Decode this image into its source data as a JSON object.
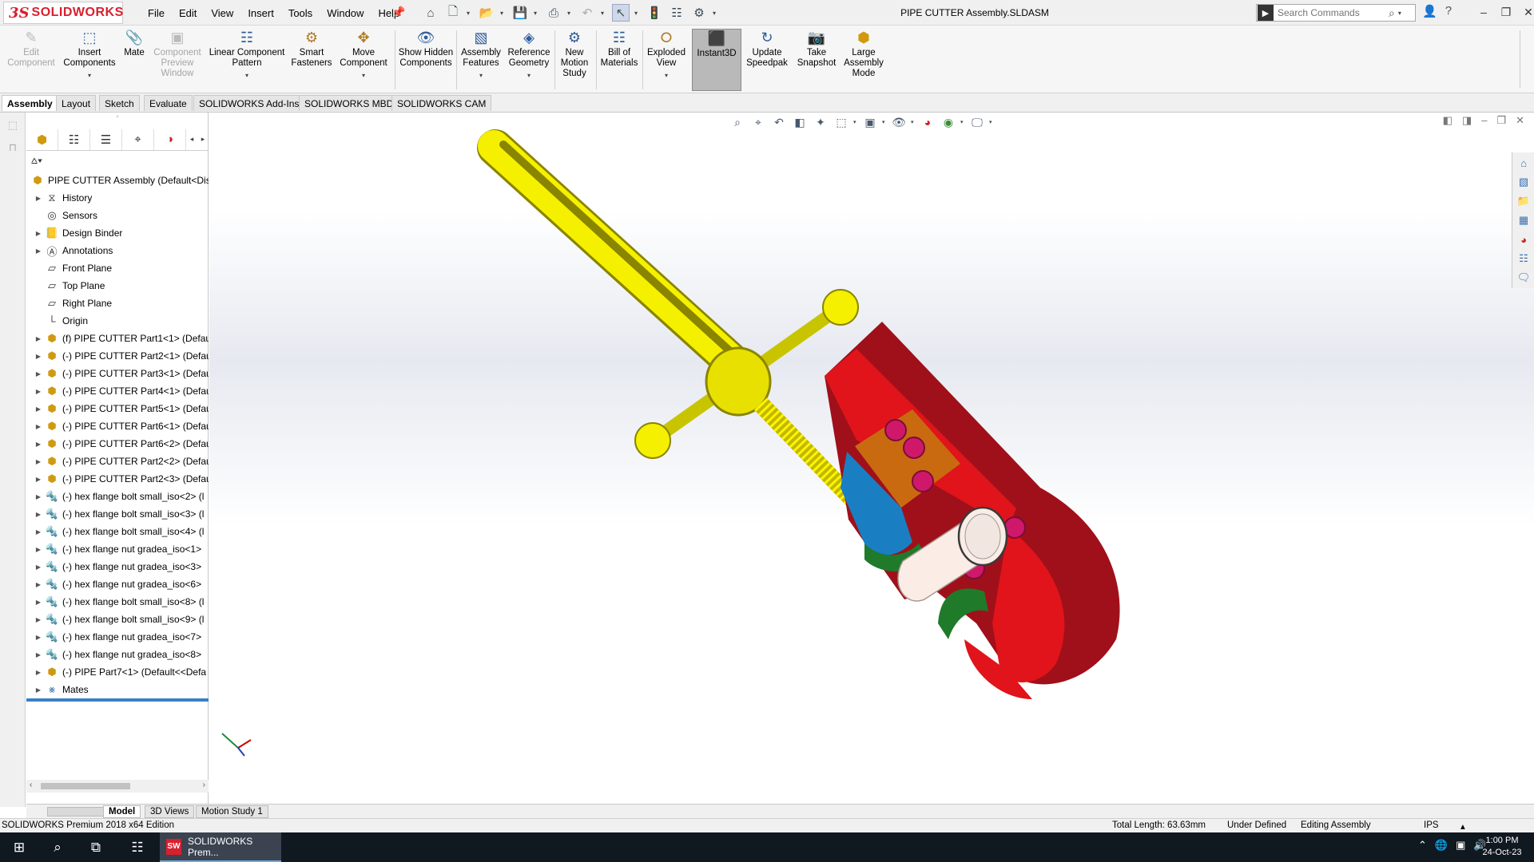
{
  "app": {
    "logo_ds": "3S",
    "logo_name": "SOLIDWORKS",
    "title": "PIPE CUTTER Assembly.SLDASM",
    "menus": [
      "File",
      "Edit",
      "View",
      "Insert",
      "Tools",
      "Window",
      "Help"
    ],
    "search_placeholder": "Search Commands"
  },
  "ribbon": [
    {
      "label": "Edit Component",
      "icon": "edit-component-icon",
      "disabled": true
    },
    {
      "label": "Insert Components",
      "icon": "insert-components-icon",
      "disabled": false,
      "dropdown": true
    },
    {
      "label": "Mate",
      "icon": "mate-icon",
      "disabled": false
    },
    {
      "label": "Component Preview Window",
      "icon": "component-preview-icon",
      "disabled": true
    },
    {
      "label": "Linear Component Pattern",
      "icon": "linear-pattern-icon",
      "disabled": false,
      "dropdown": true
    },
    {
      "label": "Smart Fasteners",
      "icon": "smart-fasteners-icon",
      "disabled": false
    },
    {
      "label": "Move Component",
      "icon": "move-component-icon",
      "disabled": false,
      "dropdown": true
    },
    {
      "label": "Show Hidden Components",
      "icon": "show-hidden-icon",
      "disabled": false
    },
    {
      "label": "Assembly Features",
      "icon": "assembly-features-icon",
      "disabled": false,
      "dropdown": true
    },
    {
      "label": "Reference Geometry",
      "icon": "reference-geometry-icon",
      "disabled": false,
      "dropdown": true
    },
    {
      "label": "New Motion Study",
      "icon": "motion-study-icon",
      "disabled": false
    },
    {
      "label": "Bill of Materials",
      "icon": "bom-icon",
      "disabled": false
    },
    {
      "label": "Exploded View",
      "icon": "exploded-view-icon",
      "disabled": false,
      "dropdown": true
    },
    {
      "label": "Instant3D",
      "icon": "instant3d-icon",
      "disabled": false,
      "active": true
    },
    {
      "label": "Update Speedpak",
      "icon": "speedpak-icon",
      "disabled": false
    },
    {
      "label": "Take Snapshot",
      "icon": "camera-icon",
      "disabled": false
    },
    {
      "label": "Large Assembly Mode",
      "icon": "large-assembly-icon",
      "disabled": false
    }
  ],
  "tabs": [
    "Assembly",
    "Layout",
    "Sketch",
    "Evaluate",
    "SOLIDWORKS Add-Ins",
    "SOLIDWORKS MBD",
    "SOLIDWORKS CAM"
  ],
  "tree": {
    "root": "PIPE CUTTER Assembly  (Default<Disp",
    "items": [
      {
        "label": "History",
        "icon": "history-icon",
        "expand": true
      },
      {
        "label": "Sensors",
        "icon": "sensors-icon",
        "expand": false
      },
      {
        "label": "Design Binder",
        "icon": "design-binder-icon",
        "expand": true
      },
      {
        "label": "Annotations",
        "icon": "annotations-icon",
        "expand": true
      },
      {
        "label": "Front Plane",
        "icon": "plane-icon",
        "expand": false
      },
      {
        "label": "Top Plane",
        "icon": "plane-icon",
        "expand": false
      },
      {
        "label": "Right Plane",
        "icon": "plane-icon",
        "expand": false
      },
      {
        "label": "Origin",
        "icon": "origin-icon",
        "expand": false
      },
      {
        "label": "(f) PIPE CUTTER Part1<1> (Default",
        "icon": "part-icon",
        "expand": true
      },
      {
        "label": "(-) PIPE CUTTER Part2<1> (Defaul",
        "icon": "part-icon",
        "expand": true
      },
      {
        "label": "(-) PIPE CUTTER Part3<1> (Defaul",
        "icon": "part-icon",
        "expand": true
      },
      {
        "label": "(-) PIPE CUTTER Part4<1> (Defaul",
        "icon": "part-icon",
        "expand": true
      },
      {
        "label": "(-) PIPE CUTTER Part5<1> (Defaul",
        "icon": "part-icon",
        "expand": true
      },
      {
        "label": "(-) PIPE CUTTER Part6<1> (Defaul",
        "icon": "part-icon",
        "expand": true
      },
      {
        "label": "(-) PIPE CUTTER Part6<2> (Defaul",
        "icon": "part-icon",
        "expand": true
      },
      {
        "label": "(-) PIPE CUTTER Part2<2> (Defaul",
        "icon": "part-icon",
        "expand": true
      },
      {
        "label": "(-) PIPE CUTTER Part2<3> (Defaul",
        "icon": "part-icon",
        "expand": true
      },
      {
        "label": "(-) hex flange bolt small_iso<2> (l",
        "icon": "toolbox-icon",
        "expand": true
      },
      {
        "label": "(-) hex flange bolt small_iso<3> (l",
        "icon": "toolbox-icon",
        "expand": true
      },
      {
        "label": "(-) hex flange bolt small_iso<4> (l",
        "icon": "toolbox-icon",
        "expand": true
      },
      {
        "label": "(-) hex flange nut gradea_iso<1>",
        "icon": "toolbox-icon",
        "expand": true
      },
      {
        "label": "(-) hex flange nut gradea_iso<3>",
        "icon": "toolbox-icon",
        "expand": true
      },
      {
        "label": "(-) hex flange nut gradea_iso<6>",
        "icon": "toolbox-icon",
        "expand": true
      },
      {
        "label": "(-) hex flange bolt small_iso<8> (l",
        "icon": "toolbox-icon",
        "expand": true
      },
      {
        "label": "(-) hex flange bolt small_iso<9> (l",
        "icon": "toolbox-icon",
        "expand": true
      },
      {
        "label": "(-) hex flange nut gradea_iso<7>",
        "icon": "toolbox-icon",
        "expand": true
      },
      {
        "label": "(-) hex flange nut gradea_iso<8>",
        "icon": "toolbox-icon",
        "expand": true
      },
      {
        "label": "(-) PIPE Part7<1> (Default<<Defa",
        "icon": "part-icon",
        "expand": true
      },
      {
        "label": "Mates",
        "icon": "mates-icon",
        "expand": true
      }
    ]
  },
  "model_tabs": [
    "Model",
    "3D Views",
    "Motion Study 1"
  ],
  "status": {
    "edition": "SOLIDWORKS Premium 2018 x64 Edition",
    "length": "Total Length: 63.63mm",
    "defined": "Under Defined",
    "mode": "Editing Assembly",
    "units": "IPS"
  },
  "taskbar": {
    "app_label": "SOLIDWORKS Prem...",
    "time": "1:00 PM",
    "date": "24-Oct-23"
  },
  "colors": {
    "handle": "#f5f000",
    "frame": "#e0141a",
    "frame_dark": "#a0101a",
    "block": "#1a7fc2",
    "wheel": "#1f7a2a",
    "pipe": "#fbece6",
    "bolt": "#d0186a"
  }
}
